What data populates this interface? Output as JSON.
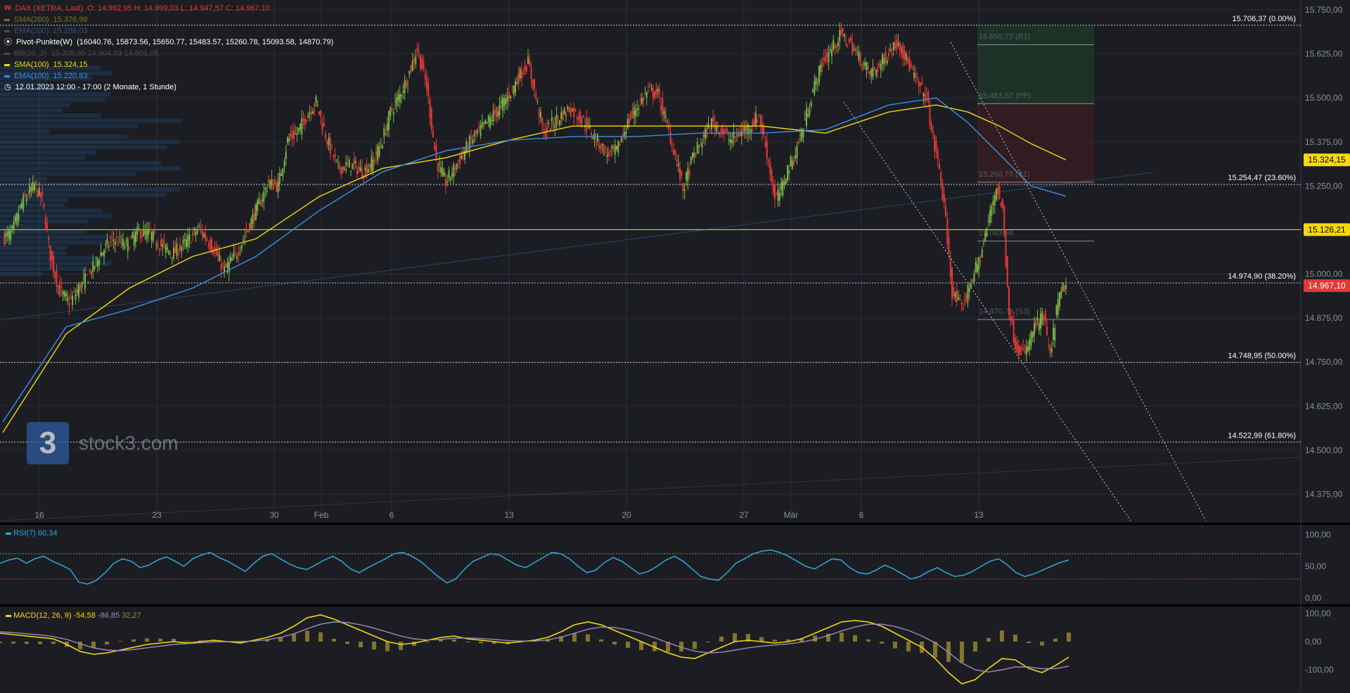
{
  "header": {
    "title": "DAX (XETRA, Last)",
    "ohlc": "O: 14.992,95  H: 14.999,03  L: 14.947,57  C: 14.967,10",
    "sma200": {
      "label": "SMA(200)",
      "value": "15.376,98"
    },
    "ema200": {
      "label": "EMA(200)",
      "value": "15.286,03"
    },
    "pivot": {
      "label": "Pivot-Punkte(W)",
      "values": "(16040.76,  15873.56,  15650.77,  15483.57,  15260.78,  15093.58,  14870.79)"
    },
    "bb": {
      "label": "BB(20, 2)",
      "value": "15.208,90  14.904,03  14.601,05"
    },
    "sma100": {
      "label": "SMA(100)",
      "value": "15.324,15"
    },
    "ema100": {
      "label": "EMA(100)",
      "value": "15.220,83"
    },
    "timeframe": "12.01.2023 12:00 - 17:00   (2 Monate, 1 Stunde)"
  },
  "watermark": {
    "glyph": "3",
    "text": "stock3.com"
  },
  "colors": {
    "bg": "#1b1d23",
    "grid": "#2a2d35",
    "up": "#7cb342",
    "down": "#e53935",
    "sma": "#f5d90a",
    "ema": "#3d8fe0",
    "rsi": "#2fa8d8",
    "macd": "#f5d90a",
    "signal": "#9c8cb8"
  },
  "chart_data": [
    {
      "type": "candlestick",
      "yticks": [
        "15.750,00",
        "15.625,00",
        "15.500,00",
        "15.375,00",
        "15.250,00",
        "15.125,00",
        "15.000,00",
        "14.875,00",
        "14.750,00",
        "14.625,00",
        "14.500,00",
        "14.375,00"
      ],
      "ylim": [
        14300,
        15750
      ],
      "xticks": [
        "16",
        "23",
        "30",
        "Feb",
        "6",
        "13",
        "20",
        "27",
        "Mär",
        "6",
        "13"
      ],
      "fib_levels": [
        {
          "value": 15706.37,
          "label": "15.706,37 (0.00%)"
        },
        {
          "value": 15254.47,
          "label": "15.254,47 (23.60%)"
        },
        {
          "value": 14974.9,
          "label": "14.974,90 (38.20%)"
        },
        {
          "value": 14748.95,
          "label": "14.748,95 (50.00%)"
        },
        {
          "value": 14522.99,
          "label": "14.522,99 (61.80%)"
        }
      ],
      "pivot_labels": [
        {
          "value": 15650.77,
          "label": "15.650,77 (R1)"
        },
        {
          "value": 15483.57,
          "label": "15.483,57 (PP)"
        },
        {
          "value": 15260.78,
          "label": "15.260,78 (S1)"
        },
        {
          "value": 15093.58,
          "label": "15.093,58"
        },
        {
          "value": 14870.79,
          "label": "14.870,79 (S3)"
        }
      ],
      "price_badges": [
        {
          "value": 15324.15,
          "label": "15.324,15",
          "color": "#f5d90a",
          "text": "#000000"
        },
        {
          "value": 15126.21,
          "label": "15.126,21",
          "color": "#f5d90a",
          "text": "#000000"
        },
        {
          "value": 14967.1,
          "label": "14.967,10",
          "color": "#e53935",
          "text": "#ffffff"
        }
      ],
      "close_path": [
        [
          0,
          15100
        ],
        [
          6,
          15120
        ],
        [
          12,
          15200
        ],
        [
          16,
          15230
        ],
        [
          20,
          15250
        ],
        [
          25,
          15210
        ],
        [
          30,
          15050
        ],
        [
          36,
          14950
        ],
        [
          42,
          14920
        ],
        [
          48,
          14960
        ],
        [
          55,
          15000
        ],
        [
          62,
          15060
        ],
        [
          70,
          15100
        ],
        [
          78,
          15080
        ],
        [
          86,
          15120
        ],
        [
          94,
          15110
        ],
        [
          100,
          15080
        ],
        [
          108,
          15060
        ],
        [
          116,
          15090
        ],
        [
          124,
          15130
        ],
        [
          132,
          15080
        ],
        [
          140,
          15010
        ],
        [
          148,
          15060
        ],
        [
          156,
          15140
        ],
        [
          162,
          15200
        ],
        [
          168,
          15260
        ],
        [
          174,
          15250
        ],
        [
          180,
          15380
        ],
        [
          186,
          15400
        ],
        [
          192,
          15450
        ],
        [
          198,
          15490
        ],
        [
          205,
          15380
        ],
        [
          212,
          15300
        ],
        [
          220,
          15310
        ],
        [
          228,
          15290
        ],
        [
          234,
          15320
        ],
        [
          240,
          15380
        ],
        [
          245,
          15460
        ],
        [
          250,
          15500
        ],
        [
          256,
          15560
        ],
        [
          262,
          15640
        ],
        [
          268,
          15530
        ],
        [
          274,
          15320
        ],
        [
          280,
          15260
        ],
        [
          288,
          15320
        ],
        [
          296,
          15380
        ],
        [
          304,
          15420
        ],
        [
          312,
          15460
        ],
        [
          320,
          15510
        ],
        [
          326,
          15560
        ],
        [
          332,
          15600
        ],
        [
          336,
          15520
        ],
        [
          342,
          15400
        ],
        [
          350,
          15440
        ],
        [
          358,
          15470
        ],
        [
          366,
          15440
        ],
        [
          374,
          15390
        ],
        [
          382,
          15340
        ],
        [
          388,
          15350
        ],
        [
          394,
          15420
        ],
        [
          400,
          15470
        ],
        [
          408,
          15520
        ],
        [
          414,
          15510
        ],
        [
          420,
          15420
        ],
        [
          426,
          15320
        ],
        [
          430,
          15240
        ],
        [
          436,
          15330
        ],
        [
          442,
          15380
        ],
        [
          448,
          15430
        ],
        [
          454,
          15410
        ],
        [
          460,
          15380
        ],
        [
          466,
          15400
        ],
        [
          472,
          15420
        ],
        [
          478,
          15450
        ],
        [
          484,
          15320
        ],
        [
          488,
          15210
        ],
        [
          492,
          15240
        ],
        [
          496,
          15300
        ],
        [
          500,
          15330
        ],
        [
          506,
          15420
        ],
        [
          512,
          15520
        ],
        [
          518,
          15600
        ],
        [
          524,
          15640
        ],
        [
          530,
          15680
        ],
        [
          536,
          15650
        ],
        [
          542,
          15610
        ],
        [
          548,
          15570
        ],
        [
          554,
          15590
        ],
        [
          560,
          15630
        ],
        [
          566,
          15660
        ],
        [
          572,
          15600
        ],
        [
          578,
          15540
        ],
        [
          584,
          15500
        ],
        [
          588,
          15380
        ],
        [
          592,
          15300
        ],
        [
          596,
          15150
        ],
        [
          600,
          14950
        ],
        [
          606,
          14900
        ],
        [
          612,
          14980
        ],
        [
          618,
          15050
        ],
        [
          624,
          15170
        ],
        [
          628,
          15250
        ],
        [
          632,
          15180
        ],
        [
          636,
          14900
        ],
        [
          640,
          14800
        ],
        [
          646,
          14770
        ],
        [
          652,
          14850
        ],
        [
          658,
          14880
        ],
        [
          662,
          14760
        ],
        [
          666,
          14900
        ],
        [
          670,
          14960
        ],
        [
          672,
          14967
        ]
      ],
      "sma100_path": [
        [
          0,
          14550
        ],
        [
          40,
          14830
        ],
        [
          80,
          14960
        ],
        [
          120,
          15050
        ],
        [
          160,
          15100
        ],
        [
          200,
          15220
        ],
        [
          240,
          15300
        ],
        [
          280,
          15330
        ],
        [
          320,
          15380
        ],
        [
          360,
          15420
        ],
        [
          400,
          15420
        ],
        [
          440,
          15420
        ],
        [
          480,
          15420
        ],
        [
          520,
          15400
        ],
        [
          560,
          15460
        ],
        [
          590,
          15480
        ],
        [
          610,
          15460
        ],
        [
          630,
          15420
        ],
        [
          650,
          15370
        ],
        [
          672,
          15324
        ]
      ],
      "ema100_path": [
        [
          0,
          14580
        ],
        [
          40,
          14850
        ],
        [
          80,
          14900
        ],
        [
          120,
          14960
        ],
        [
          160,
          15050
        ],
        [
          200,
          15180
        ],
        [
          240,
          15290
        ],
        [
          280,
          15350
        ],
        [
          320,
          15380
        ],
        [
          360,
          15390
        ],
        [
          400,
          15390
        ],
        [
          440,
          15400
        ],
        [
          480,
          15400
        ],
        [
          520,
          15410
        ],
        [
          560,
          15480
        ],
        [
          590,
          15500
        ],
        [
          610,
          15430
        ],
        [
          630,
          15340
        ],
        [
          650,
          15250
        ],
        [
          672,
          15221
        ]
      ]
    },
    {
      "type": "line",
      "name": "RSI(7)",
      "value_label": "60,34",
      "yticks": [
        "100,00",
        "50,00",
        "0,00"
      ],
      "ylim": [
        0,
        100
      ],
      "levels": [
        70,
        30
      ],
      "values": [
        55,
        60,
        63,
        55,
        62,
        66,
        58,
        52,
        45,
        25,
        22,
        28,
        40,
        55,
        62,
        58,
        48,
        52,
        60,
        65,
        58,
        50,
        62,
        68,
        72,
        64,
        58,
        50,
        42,
        55,
        66,
        70,
        62,
        54,
        48,
        45,
        52,
        60,
        66,
        58,
        46,
        40,
        48,
        55,
        62,
        70,
        72,
        66,
        58,
        46,
        34,
        24,
        30,
        45,
        58,
        64,
        70,
        68,
        60,
        52,
        48,
        56,
        64,
        72,
        70,
        62,
        50,
        40,
        44,
        56,
        64,
        58,
        48,
        38,
        42,
        50,
        60,
        66,
        58,
        46,
        34,
        30,
        28,
        40,
        55,
        62,
        70,
        74,
        76,
        72,
        66,
        58,
        50,
        46,
        54,
        62,
        60,
        48,
        40,
        38,
        44,
        52,
        46,
        38,
        30,
        34,
        42,
        48,
        40,
        34,
        36,
        42,
        50,
        58,
        62,
        52,
        40,
        34,
        38,
        44,
        50,
        56,
        60
      ]
    },
    {
      "type": "bar",
      "name": "MACD(12, 26, 9)",
      "value_labels": {
        "macd": "-54,58",
        "signal": "-86,85",
        "hist": "32,27"
      },
      "yticks": [
        "100,00",
        "0,00",
        "-100,00"
      ],
      "ylim": [
        -160,
        110
      ],
      "macd": [
        30,
        25,
        20,
        15,
        10,
        -10,
        -35,
        -45,
        -40,
        -30,
        -20,
        -10,
        -5,
        0,
        -5,
        0,
        5,
        0,
        -5,
        5,
        15,
        30,
        55,
        85,
        95,
        80,
        60,
        40,
        20,
        0,
        -10,
        -5,
        5,
        15,
        20,
        10,
        5,
        0,
        -5,
        0,
        5,
        15,
        35,
        60,
        70,
        60,
        40,
        20,
        0,
        -20,
        -40,
        -55,
        -60,
        -40,
        -20,
        0,
        5,
        0,
        -5,
        0,
        10,
        30,
        50,
        70,
        75,
        70,
        55,
        30,
        5,
        -20,
        -60,
        -110,
        -150,
        -135,
        -95,
        -60,
        -65,
        -95,
        -110,
        -85,
        -55
      ],
      "signal": [
        35,
        32,
        28,
        24,
        18,
        8,
        -8,
        -22,
        -30,
        -32,
        -28,
        -22,
        -16,
        -10,
        -7,
        -4,
        -1,
        0,
        0,
        2,
        7,
        15,
        28,
        46,
        62,
        70,
        68,
        60,
        48,
        34,
        20,
        10,
        6,
        8,
        12,
        13,
        11,
        8,
        4,
        2,
        2,
        6,
        16,
        30,
        44,
        52,
        50,
        42,
        30,
        14,
        -4,
        -20,
        -34,
        -40,
        -38,
        -30,
        -22,
        -16,
        -12,
        -8,
        -2,
        8,
        22,
        38,
        52,
        62,
        62,
        54,
        40,
        20,
        -4,
        -38,
        -76,
        -100,
        -108,
        -100,
        -90,
        -90,
        -96,
        -96,
        -87
      ]
    }
  ]
}
